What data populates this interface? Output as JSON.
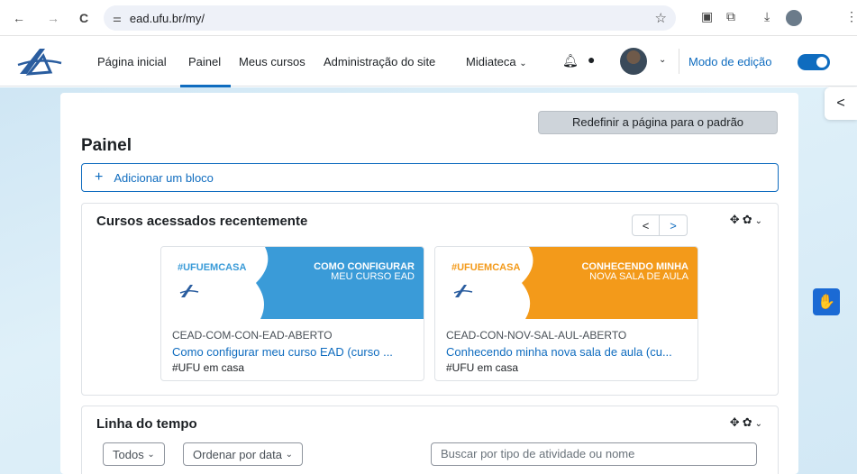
{
  "browser": {
    "url": "ead.ufu.br/my/",
    "back_icon": "←",
    "forward_icon": "→",
    "reload_icon": "C"
  },
  "navbar": {
    "items": [
      {
        "label": "Página inicial"
      },
      {
        "label": "Painel"
      },
      {
        "label": "Meus cursos"
      },
      {
        "label": "Administração do site"
      },
      {
        "label": "Midiateca"
      }
    ],
    "edit_mode_label": "Modo de edição",
    "accent": "#0f6cbf"
  },
  "page": {
    "reset_label": "Redefinir a página para o padrão",
    "title": "Painel",
    "add_block_label": "Adicionar um bloco"
  },
  "recent": {
    "title": "Cursos acessados recentemente",
    "courses": [
      {
        "tag": "#UFUEMCASA",
        "headline_1": "COMO CONFIGURAR",
        "headline_2": "MEU CURSO EAD",
        "category": "CEAD-COM-CON-EAD-ABERTO",
        "name": "Como configurar meu curso EAD (curso ...",
        "sub": "#UFU em casa",
        "banner_color": "#3a9bd8"
      },
      {
        "tag": "#UFUEMCASA",
        "headline_1": "CONHECENDO MINHA",
        "headline_2": "NOVA SALA DE AULA",
        "category": "CEAD-CON-NOV-SAL-AUL-ABERTO",
        "name": "Conhecendo minha nova sala de aula (cu...",
        "sub": "#UFU em casa",
        "banner_color": "#f39a1a"
      }
    ]
  },
  "timeline": {
    "title": "Linha do tempo",
    "filter_label": "Todos",
    "sort_label": "Ordenar por data",
    "search_placeholder": "Buscar por tipo de atividade ou nome"
  }
}
